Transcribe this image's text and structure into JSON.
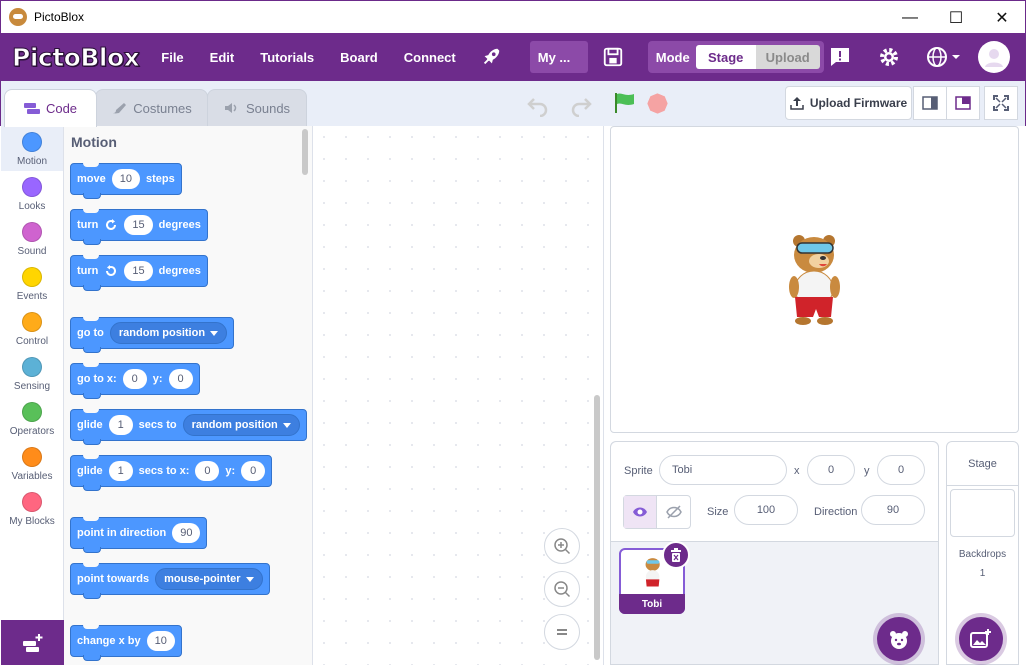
{
  "window": {
    "title": "PictoBlox"
  },
  "menubar": {
    "logo": "PictoBlox",
    "items": [
      "File",
      "Edit",
      "Tutorials",
      "Board",
      "Connect"
    ],
    "project_name": "My ...",
    "mode_label": "Mode",
    "mode_stage": "Stage",
    "mode_upload": "Upload"
  },
  "tabs": {
    "code": "Code",
    "costumes": "Costumes",
    "sounds": "Sounds"
  },
  "toolbar": {
    "upload_firmware": "Upload Firmware"
  },
  "categories": [
    {
      "label": "Motion",
      "color": "#4c97ff"
    },
    {
      "label": "Looks",
      "color": "#9966ff"
    },
    {
      "label": "Sound",
      "color": "#cf63cf"
    },
    {
      "label": "Events",
      "color": "#ffd500"
    },
    {
      "label": "Control",
      "color": "#ffab19"
    },
    {
      "label": "Sensing",
      "color": "#5cb1d6"
    },
    {
      "label": "Operators",
      "color": "#59c059"
    },
    {
      "label": "Variables",
      "color": "#ff8c1a"
    },
    {
      "label": "My Blocks",
      "color": "#ff6680"
    }
  ],
  "palette": {
    "title": "Motion",
    "move": {
      "a": "move",
      "v": "10",
      "b": "steps"
    },
    "turn_right": {
      "a": "turn",
      "v": "15",
      "b": "degrees"
    },
    "turn_left": {
      "a": "turn",
      "v": "15",
      "b": "degrees"
    },
    "goto": {
      "a": "go to",
      "dd": "random position"
    },
    "gotoxy": {
      "a": "go to x:",
      "x": "0",
      "b": "y:",
      "y": "0"
    },
    "glide": {
      "a": "glide",
      "v": "1",
      "b": "secs to",
      "dd": "random position"
    },
    "glidexy": {
      "a": "glide",
      "v": "1",
      "b": "secs to x:",
      "x": "0",
      "c": "y:",
      "y": "0"
    },
    "point_dir": {
      "a": "point in direction",
      "v": "90"
    },
    "point_towards": {
      "a": "point towards",
      "dd": "mouse-pointer"
    },
    "change_x": {
      "a": "change x by",
      "v": "10"
    }
  },
  "sprite": {
    "label_sprite": "Sprite",
    "name": "Tobi",
    "label_x": "x",
    "x": "0",
    "label_y": "y",
    "y": "0",
    "label_size": "Size",
    "size": "100",
    "label_direction": "Direction",
    "direction": "90",
    "thumb_name": "Tobi"
  },
  "stage_panel": {
    "title": "Stage",
    "backdrops_label": "Backdrops",
    "backdrops_count": "1"
  },
  "colors": {
    "accent": "#6d2b8b",
    "motion": "#4c97ff"
  }
}
